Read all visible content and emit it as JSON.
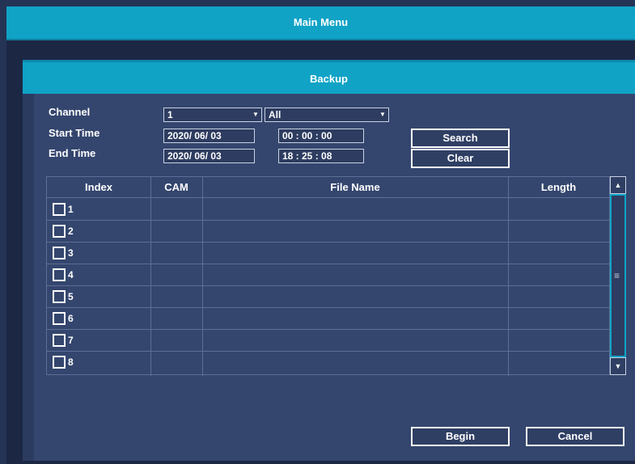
{
  "main_menu": {
    "title": "Main Menu"
  },
  "backup": {
    "title": "Backup",
    "filters": {
      "channel_label": "Channel",
      "channel_value": "1",
      "type_value": "All",
      "start_label": "Start Time",
      "start_date": "2020/ 06/ 03",
      "start_time": "00 : 00 : 00",
      "end_label": "End Time",
      "end_date": "2020/ 06/ 03",
      "end_time": "18 : 25 : 08"
    },
    "buttons": {
      "search": "Search",
      "clear": "Clear",
      "begin": "Begin",
      "cancel": "Cancel"
    },
    "table": {
      "headers": [
        "Index",
        "CAM",
        "File Name",
        "Length"
      ],
      "rows": [
        "1",
        "2",
        "3",
        "4",
        "5",
        "6",
        "7",
        "8"
      ]
    },
    "icons": {
      "dropdown": "chevron-down-icon",
      "scroll_up": "arrow-up-icon",
      "scroll_down": "arrow-down-icon",
      "grip": "grip-icon"
    },
    "colors": {
      "accent": "#10a3c6",
      "panel": "#34466e",
      "background": "#253455"
    }
  }
}
